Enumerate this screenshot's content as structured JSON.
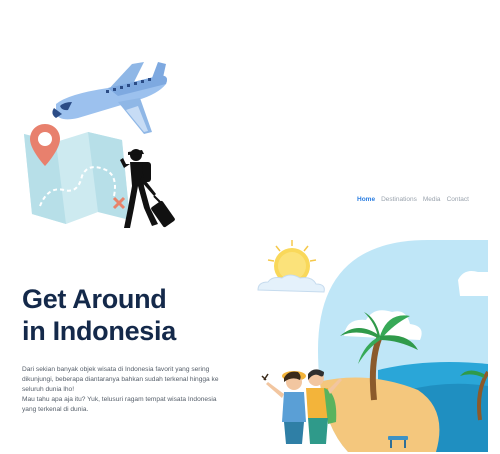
{
  "nav": {
    "items": [
      {
        "label": "Home",
        "active": true
      },
      {
        "label": "Destinations",
        "active": false
      },
      {
        "label": "Media",
        "active": false
      },
      {
        "label": "Contact",
        "active": false
      }
    ]
  },
  "hero": {
    "title_line1": "Get Around",
    "title_line2": "in Indonesia",
    "desc_p1": "Dari sekian banyak objek wisata di Indonesia favorit yang sering dikunjungi, beberapa diantaranya bahkan sudah terkenal hingga ke seluruh dunia lho!",
    "desc_p2": "Mau tahu apa aja itu? Yuk, telusuri ragam tempat wisata Indonesia yang terkenal di dunia."
  },
  "colors": {
    "accent": "#2a7de1",
    "heading": "#14294a",
    "sky": "#bfe6f7",
    "sea": "#2aa6d8",
    "sand": "#f4c77d"
  },
  "icons": [
    "airplane-icon",
    "map-icon",
    "location-pin-icon",
    "traveler-icon",
    "sun-icon",
    "palm-tree-icon"
  ]
}
